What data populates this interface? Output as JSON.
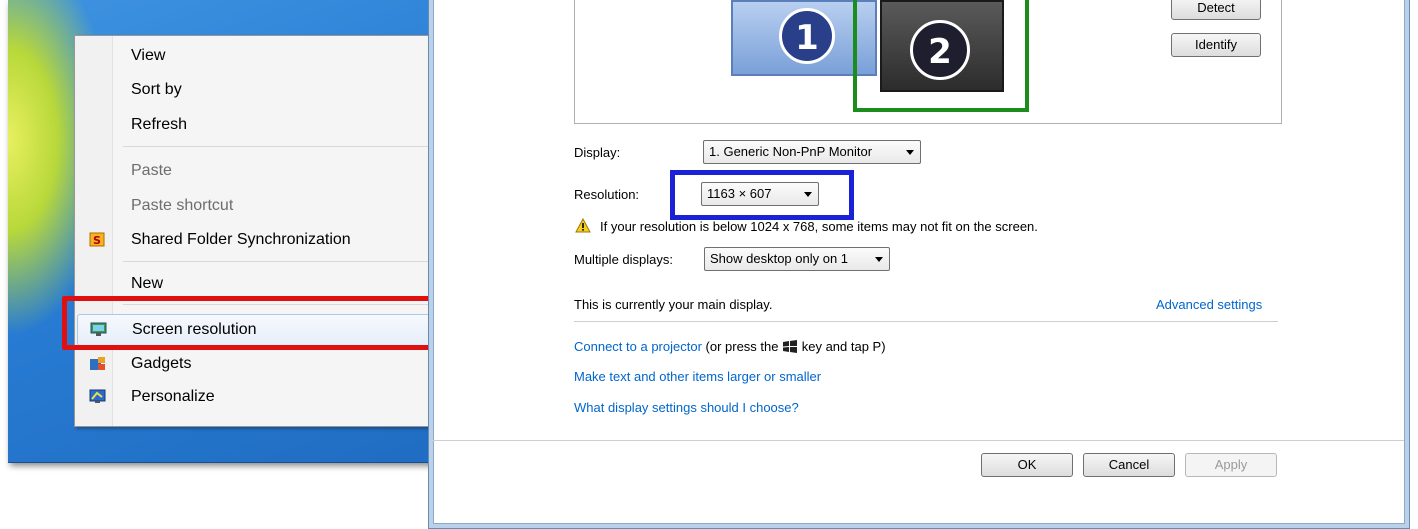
{
  "context_menu": {
    "items": [
      {
        "label": "View",
        "submenu": true,
        "disabled": false
      },
      {
        "label": "Sort by",
        "submenu": true,
        "disabled": false
      },
      {
        "label": "Refresh",
        "submenu": false,
        "disabled": false
      },
      {
        "label": "Paste",
        "submenu": false,
        "disabled": true
      },
      {
        "label": "Paste shortcut",
        "submenu": false,
        "disabled": true
      },
      {
        "label": "Shared Folder Synchronization",
        "submenu": true,
        "disabled": false,
        "icon": "shared-folder-sync-icon"
      },
      {
        "label": "New",
        "submenu": true,
        "disabled": false
      },
      {
        "label": "Screen resolution",
        "submenu": false,
        "disabled": false,
        "icon": "screen-resolution-icon",
        "highlighted": true
      },
      {
        "label": "Gadgets",
        "submenu": false,
        "disabled": false,
        "icon": "gadgets-icon"
      },
      {
        "label": "Personalize",
        "submenu": false,
        "disabled": false,
        "icon": "personalize-icon"
      }
    ]
  },
  "display_preview": {
    "monitor_1": "1",
    "monitor_2": "2",
    "detect_label": "Detect",
    "identify_label": "Identify"
  },
  "settings": {
    "display_label": "Display:",
    "display_value": "1. Generic Non-PnP Monitor",
    "resolution_label": "Resolution:",
    "resolution_value": "1163 × 607",
    "warning_text": "If your resolution is below 1024 x 768, some items may not fit on the screen.",
    "multiple_label": "Multiple displays:",
    "multiple_value": "Show desktop only on 1",
    "main_display_text": "This is currently your main display.",
    "advanced_link": "Advanced settings"
  },
  "links": {
    "projector_link": "Connect to a projector",
    "projector_suffix_1": " (or press the ",
    "projector_suffix_2": " key and tap P)",
    "text_size_link": "Make text and other items larger or smaller",
    "which_settings_link": "What display settings should I choose?"
  },
  "footer": {
    "ok_label": "OK",
    "cancel_label": "Cancel",
    "apply_label": "Apply"
  },
  "colors": {
    "highlight_red": "#e01010",
    "highlight_blue": "#1a22d8",
    "highlight_green": "#1c8c1c",
    "link": "#0066cc"
  }
}
